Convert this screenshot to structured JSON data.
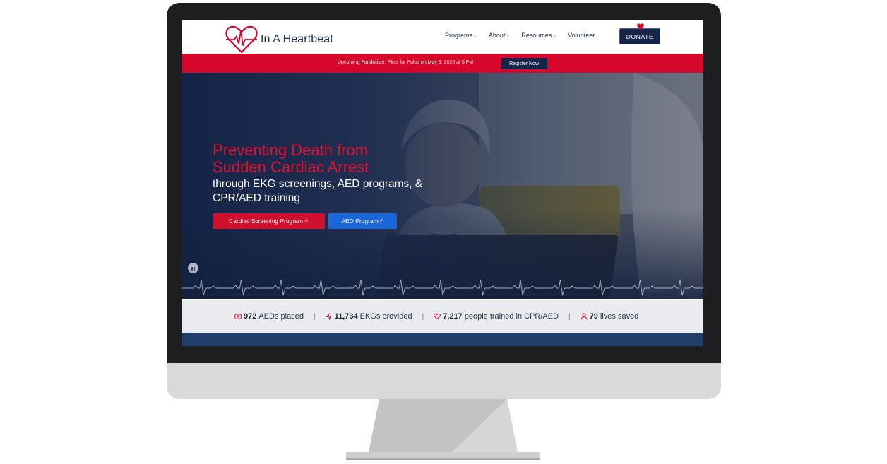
{
  "brand": {
    "name": "In A Heartbeat",
    "accent": "#d7062b",
    "navy": "#16244a",
    "blue": "#1967d8"
  },
  "nav": {
    "items": [
      {
        "label": "Programs",
        "has_dropdown": true
      },
      {
        "label": "About",
        "has_dropdown": true
      },
      {
        "label": "Resources",
        "has_dropdown": true
      },
      {
        "label": "Volunteer",
        "has_dropdown": false
      }
    ],
    "donate_label": "DONATE",
    "dropdown_icon": "chevron-down-icon"
  },
  "announcement": {
    "text": "Upcoming Fundraiser: Pints for Pulse on May 9, 2026 at 5 PM",
    "button_label": "Register Now"
  },
  "hero": {
    "title_line1": "Preventing Death from",
    "title_line2": "Sudden Cardiac Arrest",
    "subtitle_line1": "through EKG screenings, AED programs, &",
    "subtitle_line2": "CPR/AED training",
    "primary_button": "Cardiac Screening Program",
    "secondary_button": "AED Program",
    "button_arrow_icon": "circle-arrow-icon",
    "pause_icon": "pause-icon"
  },
  "stats": [
    {
      "value": "972",
      "label": "AEDs placed",
      "icon": "aed-icon"
    },
    {
      "value": "11,734",
      "label": "EKGs provided",
      "icon": "pulse-icon"
    },
    {
      "value": "7,217",
      "label": "people trained in CPR/AED",
      "icon": "heart-hand-icon"
    },
    {
      "value": "79",
      "label": "lives saved",
      "icon": "person-icon"
    }
  ],
  "stats_separator": "|",
  "arrow_glyph": "⊙",
  "chevron_glyph": "⌄"
}
